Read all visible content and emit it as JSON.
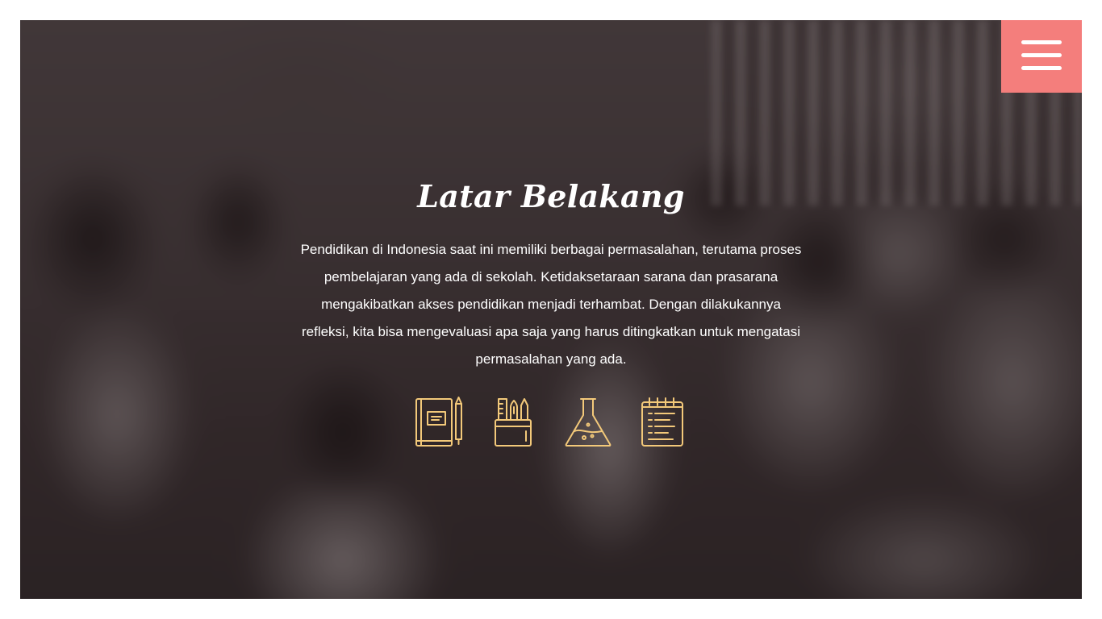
{
  "hero": {
    "title": "Latar Belakang",
    "description": "Pendidikan di Indonesia saat ini memiliki berbagai permasalahan, terutama proses pembelajaran yang ada di sekolah. Ketidaksetaraan sarana dan prasarana mengakibatkan akses pendidikan menjadi terhambat. Dengan dilakukannya refleksi, kita bisa mengevaluasi apa saja yang harus ditingkatkan untuk mengatasi permasalahan yang ada.",
    "icons": [
      "book-pencil-icon",
      "stationery-cup-icon",
      "flask-icon",
      "notepad-icon"
    ],
    "icon_color": "#f3c97a"
  },
  "menu": {
    "icon": "hamburger-menu-icon",
    "color": "#f47e7c"
  },
  "background": {
    "description_color": "#ffffff"
  }
}
